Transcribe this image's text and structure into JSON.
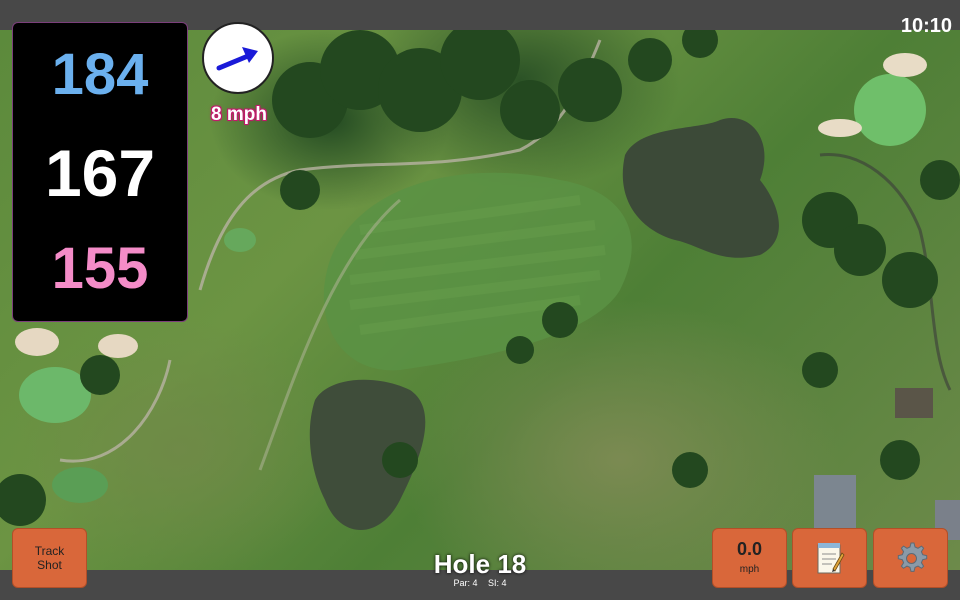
{
  "status_bar": {
    "time": "10:10"
  },
  "distances": {
    "back": "184",
    "center": "167",
    "front": "155"
  },
  "wind": {
    "speed_label": "8 mph",
    "direction_icon": "arrow-icon"
  },
  "track_shot": {
    "label_line1": "Track",
    "label_line2": "Shot"
  },
  "hole": {
    "title": "Hole 18",
    "par": "Par: 4",
    "si": "SI: 4"
  },
  "speed": {
    "value": "0.0",
    "unit": "mph"
  },
  "toolbar": {
    "notes_icon": "notepad-icon",
    "settings_icon": "gear-icon"
  },
  "colors": {
    "back_distance": "#6bb0ee",
    "center_distance": "#ffffff",
    "front_distance": "#f48cc8",
    "button": "#d9673a",
    "wind_label_outline": "#c2186b"
  }
}
